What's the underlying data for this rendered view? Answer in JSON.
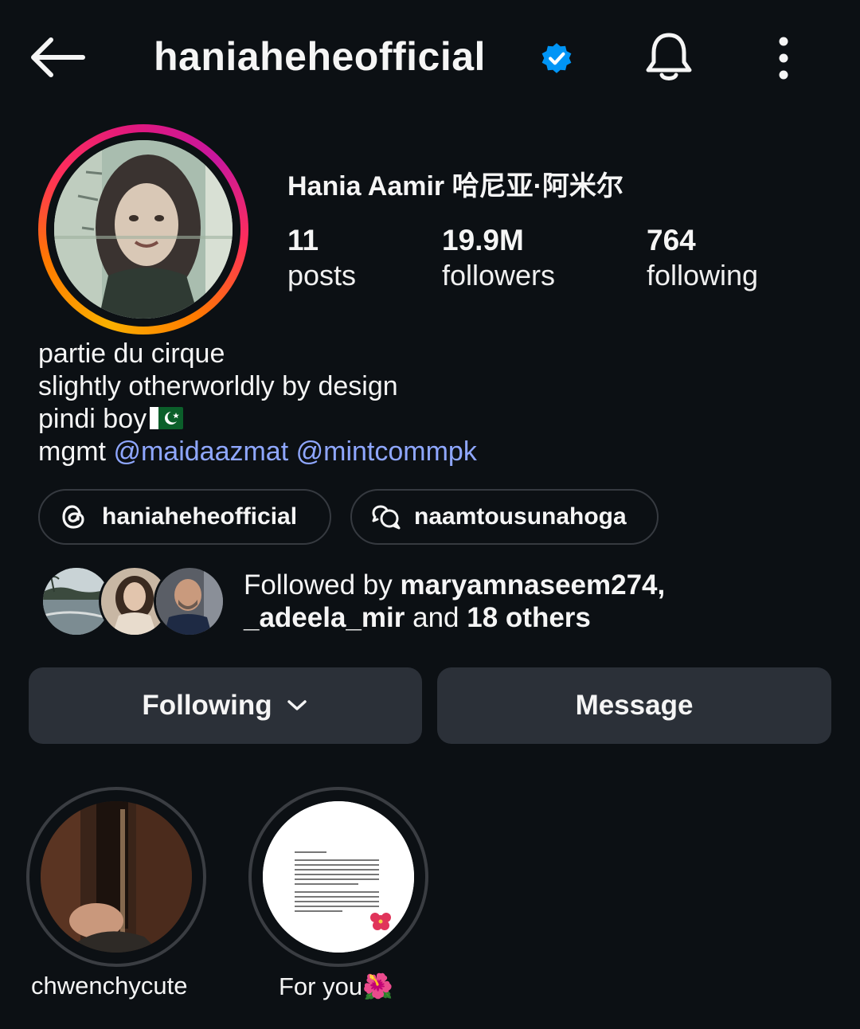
{
  "header": {
    "username": "haniaheheofficial",
    "verified": true,
    "icons": [
      "back-arrow-icon",
      "verified-badge-icon",
      "bell-icon",
      "more-vertical-icon"
    ]
  },
  "profile": {
    "display_name": "Hania Aamir 哈尼亚·阿米尔",
    "stats": {
      "posts": {
        "value": "11",
        "label": "posts"
      },
      "followers": {
        "value": "19.9M",
        "label": "followers"
      },
      "following": {
        "value": "764",
        "label": "following"
      }
    },
    "bio": {
      "line1": "partie du cirque",
      "line2": "slightly otherworldly by design",
      "line3": "pindi boy",
      "line4_prefix": "mgmt",
      "mention1": "@maidaazmat",
      "mention2": "@mintcommpk"
    }
  },
  "links": {
    "threads": "haniaheheofficial",
    "chat": "naamtousunahoga"
  },
  "followed_by": {
    "prefix": "Followed by",
    "user1": "maryamnaseem274,",
    "user2": "_adeela_mir",
    "and": "and",
    "others": "18 others"
  },
  "actions": {
    "following": "Following",
    "message": "Message"
  },
  "highlights": [
    {
      "label": "chwenchycute"
    },
    {
      "label": "For you🌺"
    }
  ],
  "colors": {
    "background": "#0c1014",
    "mention": "#8fa7ff",
    "button": "#2b3038",
    "verified": "#0095f6"
  }
}
